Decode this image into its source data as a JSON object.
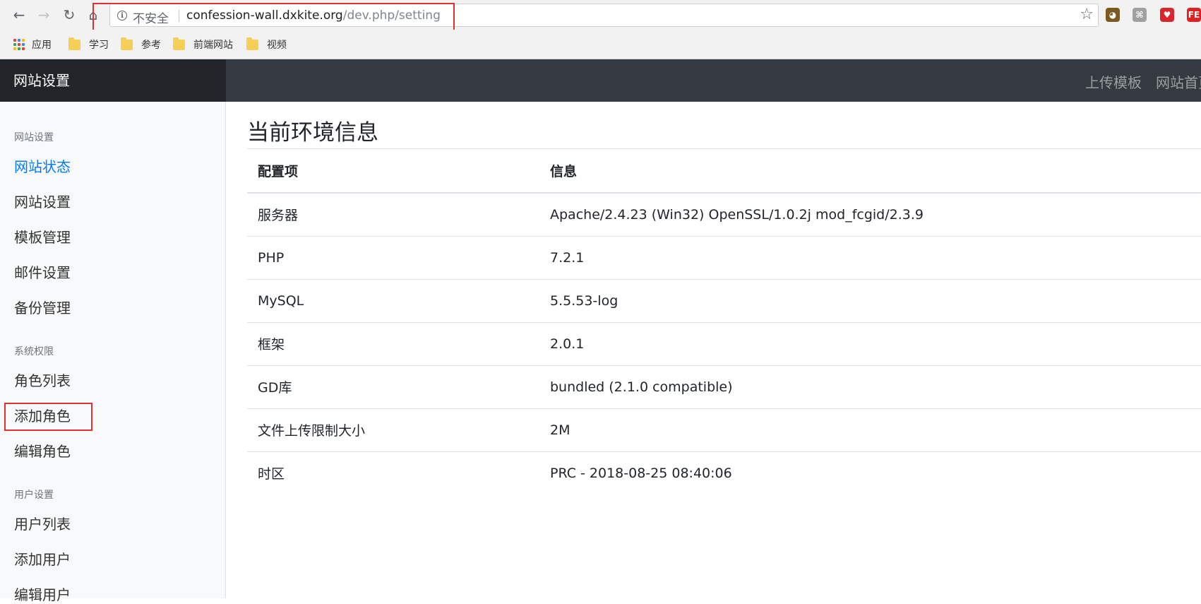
{
  "browser": {
    "security_label": "不安全",
    "url_host": "confession-wall.dxkite.org",
    "url_path": "/dev.php/setting",
    "bookmarks": [
      {
        "label": "应用",
        "icon": "apps-grid-icon"
      },
      {
        "label": "学习",
        "icon": "folder-icon"
      },
      {
        "label": "参考",
        "icon": "folder-icon"
      },
      {
        "label": "前端网站",
        "icon": "folder-icon"
      },
      {
        "label": "视频",
        "icon": "folder-icon"
      }
    ],
    "extensions": [
      {
        "icon": "cookie-extension-icon",
        "glyph": "◕",
        "color": "#7a5a1e"
      },
      {
        "icon": "command-extension-icon",
        "glyph": "⌘",
        "color": "#a0a0a0"
      },
      {
        "icon": "red-extension-icon",
        "glyph": "♥",
        "color": "#d9262c"
      },
      {
        "icon": "fe-extension-icon",
        "glyph": "FE",
        "color": "#e02020"
      }
    ]
  },
  "header": {
    "brand": "网站设置",
    "links": [
      "上传模板",
      "网站首页"
    ]
  },
  "sidebar": {
    "sections": [
      {
        "heading": "网站设置",
        "items": [
          "网站状态",
          "网站设置",
          "模板管理",
          "邮件设置",
          "备份管理"
        ]
      },
      {
        "heading": "系统权限",
        "items": [
          "角色列表",
          "添加角色",
          "编辑角色"
        ]
      },
      {
        "heading": "用户设置",
        "items": [
          "用户列表",
          "添加用户",
          "编辑用户"
        ]
      }
    ],
    "active_item": "网站状态"
  },
  "main": {
    "title": "当前环境信息",
    "columns": [
      "配置项",
      "信息"
    ],
    "rows": [
      [
        "服务器",
        "Apache/2.4.23 (Win32) OpenSSL/1.0.2j mod_fcgid/2.3.9"
      ],
      [
        "PHP",
        "7.2.1"
      ],
      [
        "MySQL",
        "5.5.53-log"
      ],
      [
        "框架",
        "2.0.1"
      ],
      [
        "GD库",
        "bundled (2.1.0 compatible)"
      ],
      [
        "文件上传限制大小",
        "2M"
      ],
      [
        "时区",
        "PRC - 2018-08-25 08:40:06"
      ]
    ]
  },
  "colors": {
    "active_link": "#007bff",
    "header_bg": "#343a40",
    "brand_bg": "#212529",
    "annotation_red": "#e03030"
  }
}
